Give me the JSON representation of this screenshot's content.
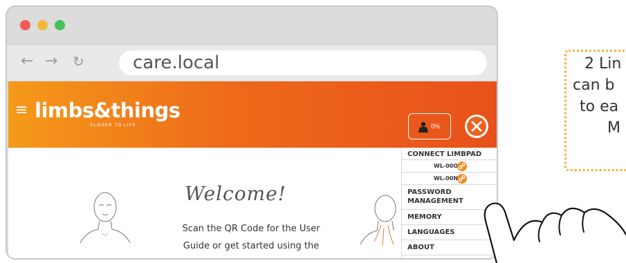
{
  "browser": {
    "url": "care.local",
    "nav_back": "←",
    "nav_forward": "→",
    "nav_reload": "↻"
  },
  "app": {
    "brand": "limbs&things",
    "tagline": "CLOSER TO LIFE",
    "limb_percent": "0%",
    "menu_icon": "≡"
  },
  "welcome": {
    "title": "Welcome!",
    "line1": "Scan the QR Code for the User",
    "line2": "Guide or get started using the"
  },
  "menu": {
    "connect": "CONNECT LIMBPAD",
    "devices": [
      "WL-00O",
      "WL-00N"
    ],
    "password_line1": "PASSWORD",
    "password_line2": "MANAGEMENT",
    "memory": "MEMORY",
    "languages": "LANGUAGES",
    "about": "ABOUT"
  },
  "callout": {
    "line1": "2 Lin",
    "line2": "can b",
    "line3": "to ea",
    "line4": "M"
  },
  "colors": {
    "header_start": "#f59a1a",
    "header_end": "#e8511b",
    "accent_orange": "#f08a1d",
    "callout_border": "#f3b23a"
  }
}
